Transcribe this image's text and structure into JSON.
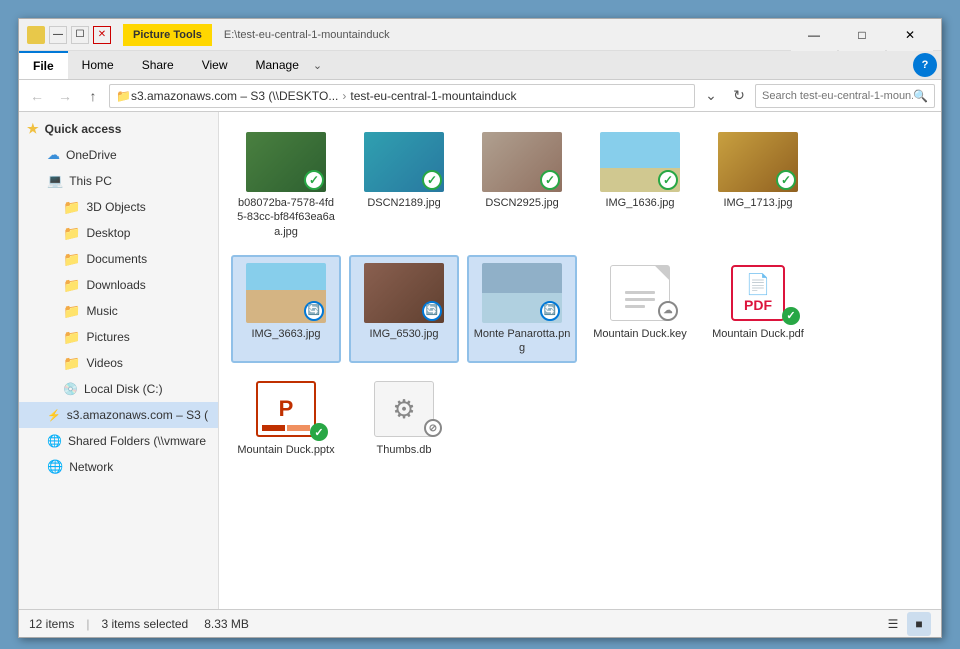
{
  "window": {
    "title": "Picture Tools",
    "path": "E:\\test-eu-central-1-mountainduck"
  },
  "ribbon": {
    "tabs": [
      "File",
      "Home",
      "Share",
      "View",
      "Manage"
    ],
    "active_tab": "File",
    "picture_tools_label": "Picture Tools"
  },
  "addressbar": {
    "path_parts": [
      "s3.amazonaws.com – S3 (\\\\DESKTО...",
      "test-eu-central-1-mountainduck"
    ],
    "search_placeholder": "Search test-eu-central-1-moun..."
  },
  "sidebar": {
    "items": [
      {
        "label": "Quick access",
        "icon": "star",
        "type": "section"
      },
      {
        "label": "OneDrive",
        "icon": "cloud",
        "indent": 1
      },
      {
        "label": "This PC",
        "icon": "pc",
        "indent": 1
      },
      {
        "label": "3D Objects",
        "icon": "folder",
        "indent": 2
      },
      {
        "label": "Desktop",
        "icon": "folder",
        "indent": 2
      },
      {
        "label": "Documents",
        "icon": "folder",
        "indent": 2
      },
      {
        "label": "Downloads",
        "icon": "folder",
        "indent": 2
      },
      {
        "label": "Music",
        "icon": "folder",
        "indent": 2
      },
      {
        "label": "Pictures",
        "icon": "folder",
        "indent": 2
      },
      {
        "label": "Videos",
        "icon": "folder",
        "indent": 2
      },
      {
        "label": "Local Disk (C:)",
        "icon": "disk",
        "indent": 2
      },
      {
        "label": "s3.amazonaws.com – S3 (",
        "icon": "s3",
        "indent": 1,
        "active": true
      },
      {
        "label": "Shared Folders (\\\\vmware",
        "icon": "share",
        "indent": 1
      },
      {
        "label": "Network",
        "icon": "network",
        "indent": 1
      }
    ]
  },
  "files": [
    {
      "name": "b08072ba-7578-4fd5-83cc-bf84f63ea6aa.jpg",
      "type": "image",
      "thumb_color": "thumb-green",
      "badge": "check",
      "selected": false
    },
    {
      "name": "DSCN2189.jpg",
      "type": "image",
      "thumb_color": "thumb-teal",
      "badge": "check",
      "selected": false
    },
    {
      "name": "DSCN2925.jpg",
      "type": "image",
      "thumb_color": "thumb-rock",
      "badge": "check",
      "selected": false
    },
    {
      "name": "IMG_1636.jpg",
      "type": "image",
      "thumb_color": "thumb-sky",
      "badge": "check",
      "selected": false
    },
    {
      "name": "IMG_1713.jpg",
      "type": "image",
      "thumb_color": "thumb-yellow",
      "badge": "check",
      "selected": false
    },
    {
      "name": "IMG_3663.jpg",
      "type": "image",
      "thumb_color": "thumb-beach",
      "badge": "sync",
      "selected": true
    },
    {
      "name": "IMG_6530.jpg",
      "type": "image",
      "thumb_color": "thumb-stone",
      "badge": "sync",
      "selected": true
    },
    {
      "name": "Monte Panarotta.png",
      "type": "image",
      "thumb_color": "thumb-mountain",
      "badge": "sync",
      "selected": true
    },
    {
      "name": "Mountain Duck.key",
      "type": "key",
      "badge": "cloud",
      "selected": false
    },
    {
      "name": "Mountain Duck.pdf",
      "type": "pdf",
      "badge": "check-green",
      "selected": false
    },
    {
      "name": "Mountain Duck.pptx",
      "type": "pptx",
      "badge": "check-green",
      "selected": false
    },
    {
      "name": "Thumbs.db",
      "type": "db",
      "badge": "blocked",
      "selected": false
    }
  ],
  "statusbar": {
    "item_count": "12 items",
    "selection": "3 items selected",
    "size": "8.33 MB"
  }
}
